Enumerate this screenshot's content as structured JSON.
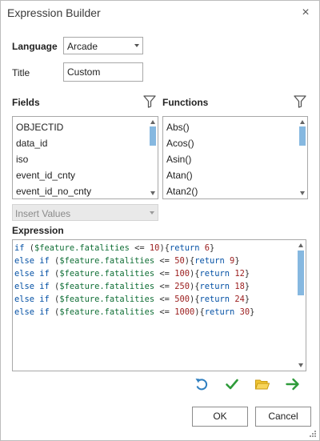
{
  "window": {
    "title": "Expression Builder",
    "close_label": "×"
  },
  "form": {
    "language_label": "Language",
    "language_value": "Arcade",
    "title_label": "Title",
    "title_value": "Custom"
  },
  "fields": {
    "header": "Fields",
    "items": [
      "OBJECTID",
      "data_id",
      "iso",
      "event_id_cnty",
      "event_id_no_cnty"
    ]
  },
  "functions": {
    "header": "Functions",
    "items": [
      "Abs()",
      "Acos()",
      "Asin()",
      "Atan()",
      "Atan2()"
    ]
  },
  "insert_values": {
    "label": "Insert Values"
  },
  "expression": {
    "header": "Expression",
    "lines": [
      {
        "kw": "if",
        "open": " (",
        "var": "$feature.fatalities",
        "op": " <= ",
        "num": "10",
        "mid": "){",
        "ret": "return",
        "val": "6",
        "close": "}"
      },
      {
        "kw": "else if",
        "open": " (",
        "var": "$feature.fatalities",
        "op": " <= ",
        "num": "50",
        "mid": "){",
        "ret": "return",
        "val": "9",
        "close": "}"
      },
      {
        "kw": "else if",
        "open": " (",
        "var": "$feature.fatalities",
        "op": " <= ",
        "num": "100",
        "mid": "){",
        "ret": "return",
        "val": "12",
        "close": "}"
      },
      {
        "kw": "else if",
        "open": " (",
        "var": "$feature.fatalities",
        "op": " <= ",
        "num": "250",
        "mid": "){",
        "ret": "return",
        "val": "18",
        "close": "}"
      },
      {
        "kw": "else if",
        "open": " (",
        "var": "$feature.fatalities",
        "op": " <= ",
        "num": "500",
        "mid": "){",
        "ret": "return",
        "val": "24",
        "close": "}"
      },
      {
        "kw": "else if",
        "open": " (",
        "var": "$feature.fatalities",
        "op": " <= ",
        "num": "1000",
        "mid": "){",
        "ret": "return",
        "val": "30",
        "close": "}"
      }
    ]
  },
  "toolbar": {
    "icons": [
      "undo-icon",
      "verify-checkmark-icon",
      "open-folder-icon",
      "export-arrow-icon"
    ]
  },
  "buttons": {
    "ok": "OK",
    "cancel": "Cancel"
  },
  "colors": {
    "keyword": "#0451a5",
    "global_variable": "#0f6e35",
    "number": "#9b1d1d",
    "scroll_thumb": "#86b8e0",
    "undo": "#2f7fc0",
    "check": "#2e9b3a",
    "folder": "#e0b31b",
    "arrow": "#2e9b3a"
  }
}
